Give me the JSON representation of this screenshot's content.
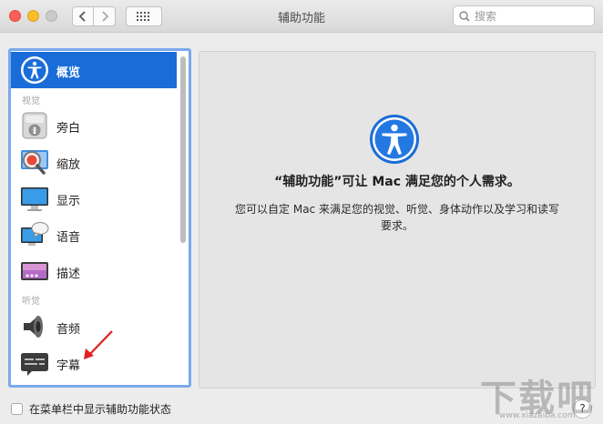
{
  "window": {
    "title": "辅助功能"
  },
  "search": {
    "placeholder": "搜索"
  },
  "sidebar": {
    "selected": {
      "label": "概览",
      "icon": "accessibility-icon"
    },
    "sections": [
      {
        "header": "视觉",
        "items": [
          {
            "label": "旁白",
            "icon": "voiceover-icon"
          },
          {
            "label": "缩放",
            "icon": "zoom-icon"
          },
          {
            "label": "显示",
            "icon": "display-icon"
          },
          {
            "label": "语音",
            "icon": "speech-icon"
          },
          {
            "label": "描述",
            "icon": "descriptions-icon"
          }
        ]
      },
      {
        "header": "听觉",
        "items": [
          {
            "label": "音频",
            "icon": "speaker-icon"
          },
          {
            "label": "字幕",
            "icon": "captions-icon"
          }
        ]
      }
    ]
  },
  "detail": {
    "title": "“辅助功能”可让 Mac 满足您的个人需求。",
    "description": "您可以自定 Mac 来满足您的视觉、听觉、身体动作以及学习和读写要求。"
  },
  "footer": {
    "checkbox_label": "在菜单栏中显示辅助功能状态",
    "checked": false,
    "help": "?"
  },
  "watermark": {
    "text": "下载吧",
    "url": "www.xiazaiba.com"
  },
  "colors": {
    "selection": "#1a6dd8",
    "focus_ring": "#7aa9ec",
    "annotation_arrow": "#e02020"
  }
}
